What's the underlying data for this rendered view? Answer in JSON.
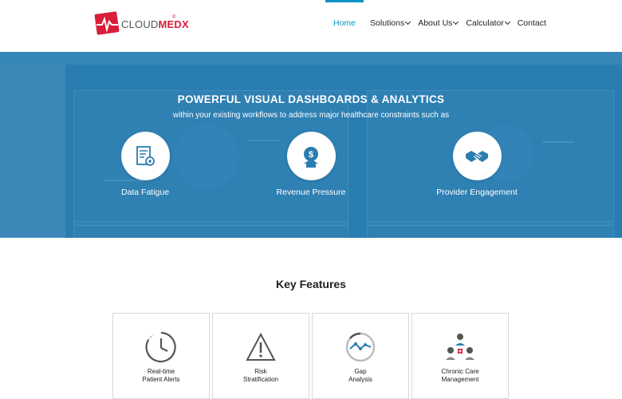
{
  "brand": {
    "name_prefix": "CLOUD",
    "name_suffix": "MEDX",
    "reg": "®"
  },
  "nav": {
    "items": [
      {
        "label": "Home",
        "active": true,
        "dropdown": false
      },
      {
        "label": "Solutions",
        "active": false,
        "dropdown": true
      },
      {
        "label": "About Us",
        "active": false,
        "dropdown": true
      },
      {
        "label": "Calculator",
        "active": false,
        "dropdown": true
      },
      {
        "label": "Contact",
        "active": false,
        "dropdown": false
      }
    ]
  },
  "hero": {
    "title": "POWERFUL VISUAL DASHBOARDS & ANALYTICS",
    "subtitle": "within your existing workflows to address major healthcare constraints such as",
    "features": [
      {
        "label": "Data Fatigue",
        "icon": "data-report-icon"
      },
      {
        "label": "Revenue Pressure",
        "icon": "dollar-pressure-icon"
      },
      {
        "label": "Provider Engagement",
        "icon": "handshake-icon"
      }
    ]
  },
  "key_features": {
    "title": "Key Features",
    "cards": [
      {
        "line1": "Real-time",
        "line2": "Patient Alerts",
        "icon": "clock-icon"
      },
      {
        "line1": "Risk",
        "line2": "Stratification",
        "icon": "warning-icon"
      },
      {
        "line1": "Gap",
        "line2": "Analysis",
        "icon": "gap-analysis-icon"
      },
      {
        "line1": "Chronic Care",
        "line2": "Management",
        "icon": "care-team-icon"
      }
    ]
  },
  "colors": {
    "accent": "#0a93c4",
    "hero_bg": "#2a7db1",
    "brand_red": "#d81e3a"
  }
}
